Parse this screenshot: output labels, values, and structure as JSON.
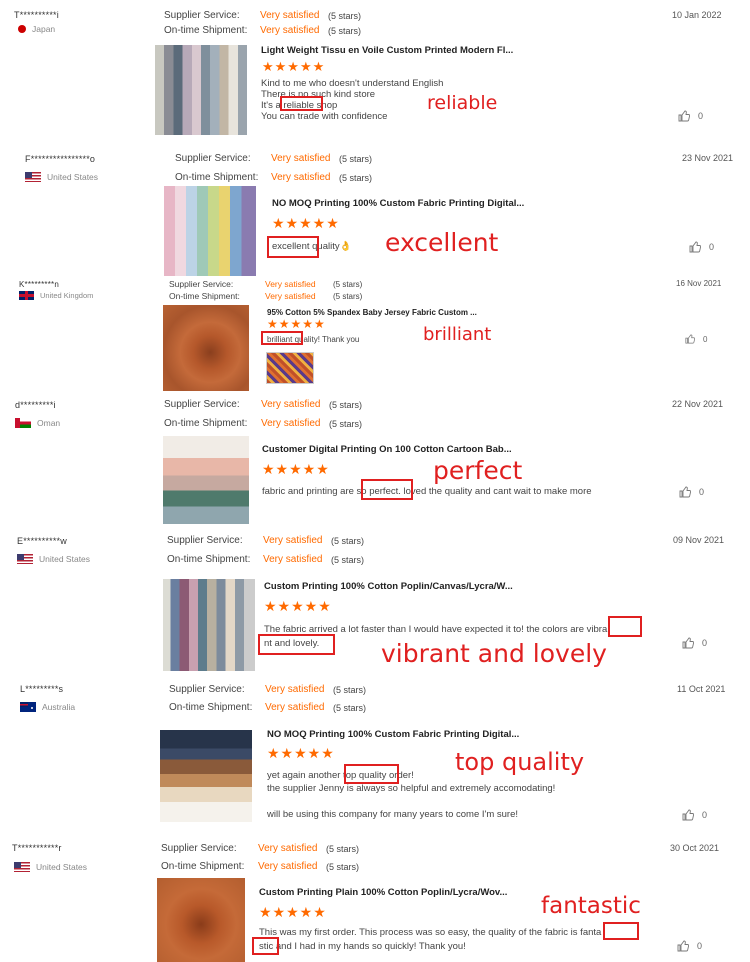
{
  "labels": {
    "supplier": "Supplier Service:",
    "shipment": "On-time Shipment:",
    "rating": "Very satisfied",
    "stars": "(5 stars)"
  },
  "colors": {
    "accent": "#ff6a00",
    "highlight": "#e02020"
  },
  "reviews": [
    {
      "user": "T**********i",
      "country": "Japan",
      "flag": "jp-flag",
      "date": "10 Jan 2022",
      "title": "Light Weight Tissu en Voile Custom Printed Modern Fl...",
      "lines": [
        "Kind to me who doesn't understand English",
        "There is no such kind store",
        "It's a reliable shop",
        "You can trade with confidence"
      ],
      "likes": "0",
      "note": "reliable"
    },
    {
      "user": "F****************o",
      "country": "United States",
      "flag": "us-flag",
      "date": "23 Nov 2021",
      "title": "NO MOQ Printing 100% Custom Fabric Printing Digital...",
      "lines": [
        "excellent quality👌"
      ],
      "likes": "0",
      "note": "excellent"
    },
    {
      "user": "K*********n",
      "country": "United Kingdom",
      "flag": "uk-flag",
      "date": "16 Nov 2021",
      "title": "95% Cotton 5% Spandex Baby Jersey Fabric Custom ...",
      "lines": [
        "brilliant quality! Thank you"
      ],
      "likes": "0",
      "note": "brilliant"
    },
    {
      "user": "d*********i",
      "country": "Oman",
      "flag": "om-flag",
      "date": "22 Nov 2021",
      "title": "Customer Digital Printing On 100 Cotton Cartoon Bab...",
      "lines": [
        "fabric and printing are so perfect. loved the quality and cant wait to make more"
      ],
      "likes": "0",
      "note": "perfect"
    },
    {
      "user": "E**********w",
      "country": "United States",
      "flag": "us-flag",
      "date": "09 Nov 2021",
      "title": "Custom Printing 100% Cotton Poplin/Canvas/Lycra/W...",
      "lines": [
        "The fabric arrived a lot faster than I would have expected it to! the colors are vibra",
        "nt and lovely."
      ],
      "likes": "0",
      "note": "vibrant and lovely"
    },
    {
      "user": "L*********s",
      "country": "Australia",
      "flag": "au-flag",
      "date": "11 Oct 2021",
      "title": "NO MOQ Printing 100% Custom Fabric Printing Digital...",
      "lines": [
        "yet again another top quality order!",
        "the supplier Jenny is always so helpful and extremely accomodating!",
        "",
        "will be using this company for many years to come I'm sure!"
      ],
      "likes": "0",
      "note": "top quality"
    },
    {
      "user": "T***********r",
      "country": "United States",
      "flag": "us-flag",
      "date": "30 Oct 2021",
      "title": "Custom Printing Plain 100% Cotton Poplin/Lycra/Wov...",
      "lines": [
        "This was my first order. This process was so easy, the quality of the fabric is fanta",
        "stic and I had in my hands so quickly! Thank you!"
      ],
      "likes": "0",
      "note": "fantastic"
    }
  ]
}
